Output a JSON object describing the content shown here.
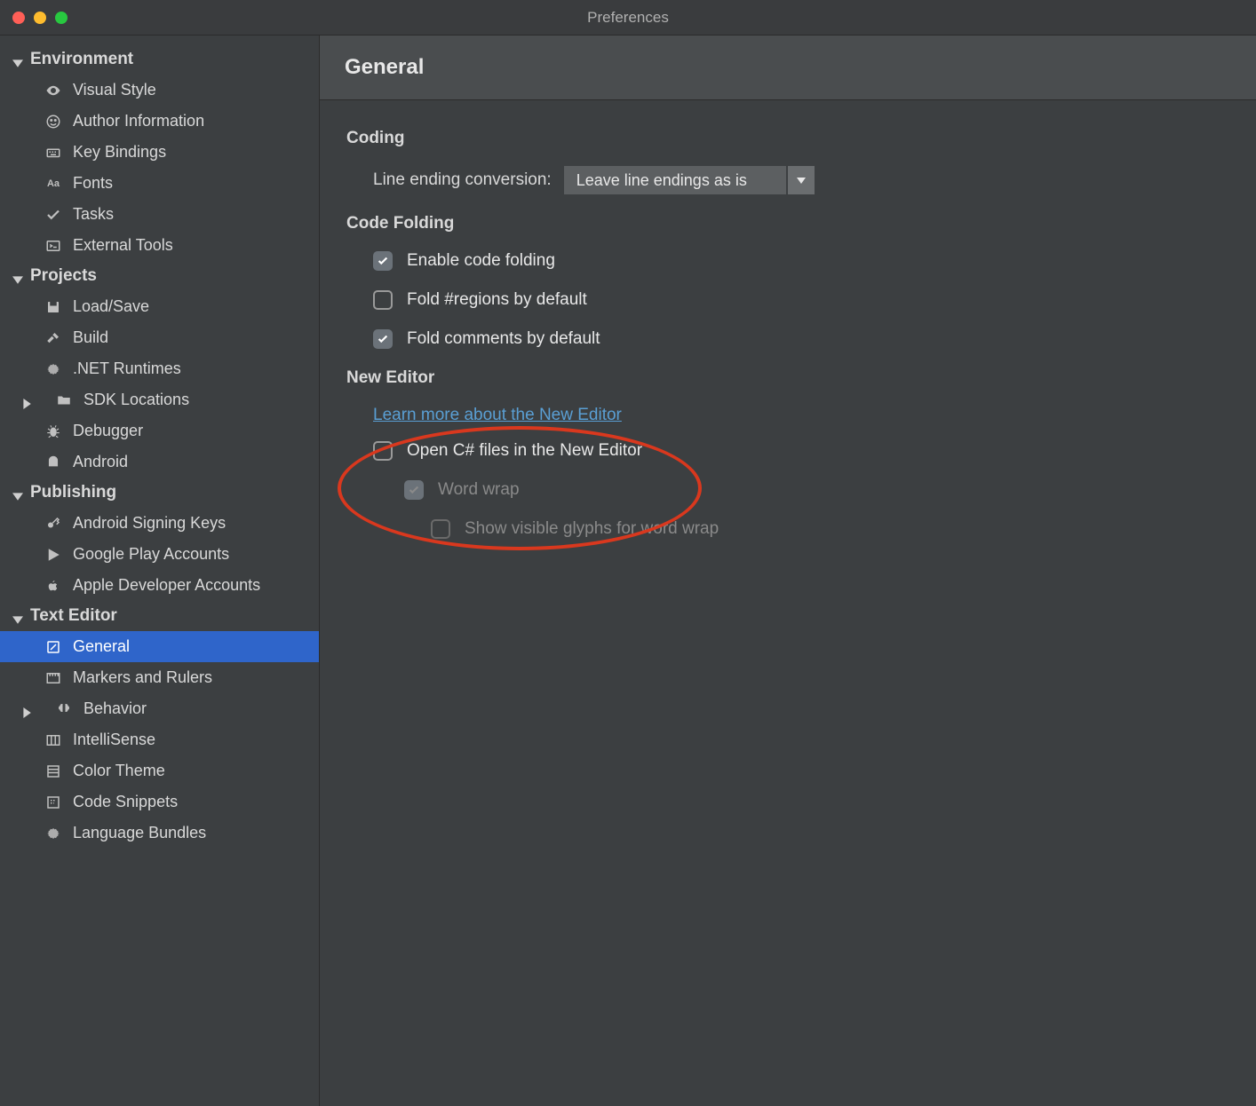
{
  "window": {
    "title": "Preferences"
  },
  "sidebar": {
    "groups": [
      {
        "label": "Environment",
        "items": [
          {
            "icon": "eye",
            "label": "Visual Style"
          },
          {
            "icon": "smiley",
            "label": "Author Information"
          },
          {
            "icon": "keyboard",
            "label": "Key Bindings"
          },
          {
            "icon": "fonts",
            "label": "Fonts"
          },
          {
            "icon": "check",
            "label": "Tasks"
          },
          {
            "icon": "terminal",
            "label": "External Tools"
          }
        ]
      },
      {
        "label": "Projects",
        "items": [
          {
            "icon": "disk",
            "label": "Load/Save"
          },
          {
            "icon": "hammer",
            "label": "Build"
          },
          {
            "icon": "gear",
            "label": ".NET Runtimes"
          },
          {
            "icon": "folder",
            "label": "SDK Locations",
            "expandable": true
          },
          {
            "icon": "bug",
            "label": "Debugger"
          },
          {
            "icon": "android",
            "label": "Android"
          }
        ]
      },
      {
        "label": "Publishing",
        "items": [
          {
            "icon": "key",
            "label": "Android Signing Keys"
          },
          {
            "icon": "play",
            "label": "Google Play Accounts"
          },
          {
            "icon": "apple",
            "label": "Apple Developer Accounts"
          }
        ]
      },
      {
        "label": "Text Editor",
        "items": [
          {
            "icon": "pencil",
            "label": "General",
            "selected": true
          },
          {
            "icon": "ruler",
            "label": "Markers and Rulers"
          },
          {
            "icon": "brain",
            "label": "Behavior",
            "expandable": true
          },
          {
            "icon": "columns",
            "label": "IntelliSense"
          },
          {
            "icon": "palette",
            "label": "Color Theme"
          },
          {
            "icon": "snippet",
            "label": "Code Snippets"
          },
          {
            "icon": "gear",
            "label": "Language Bundles"
          }
        ]
      }
    ]
  },
  "panel": {
    "title": "General",
    "sections": {
      "coding": {
        "title": "Coding",
        "line_ending_label": "Line ending conversion:",
        "line_ending_value": "Leave line endings as is"
      },
      "folding": {
        "title": "Code Folding",
        "enable": {
          "label": "Enable code folding",
          "checked": true
        },
        "regions": {
          "label": "Fold #regions by default",
          "checked": false
        },
        "comments": {
          "label": "Fold comments by default",
          "checked": true
        }
      },
      "new_editor": {
        "title": "New Editor",
        "learn_more": "Learn more about the New Editor",
        "open_csharp": {
          "label": "Open C# files in the New Editor",
          "checked": false
        },
        "word_wrap": {
          "label": "Word wrap",
          "checked": true,
          "disabled": true
        },
        "glyphs": {
          "label": "Show visible glyphs for word wrap",
          "checked": false,
          "disabled": true
        }
      }
    }
  }
}
